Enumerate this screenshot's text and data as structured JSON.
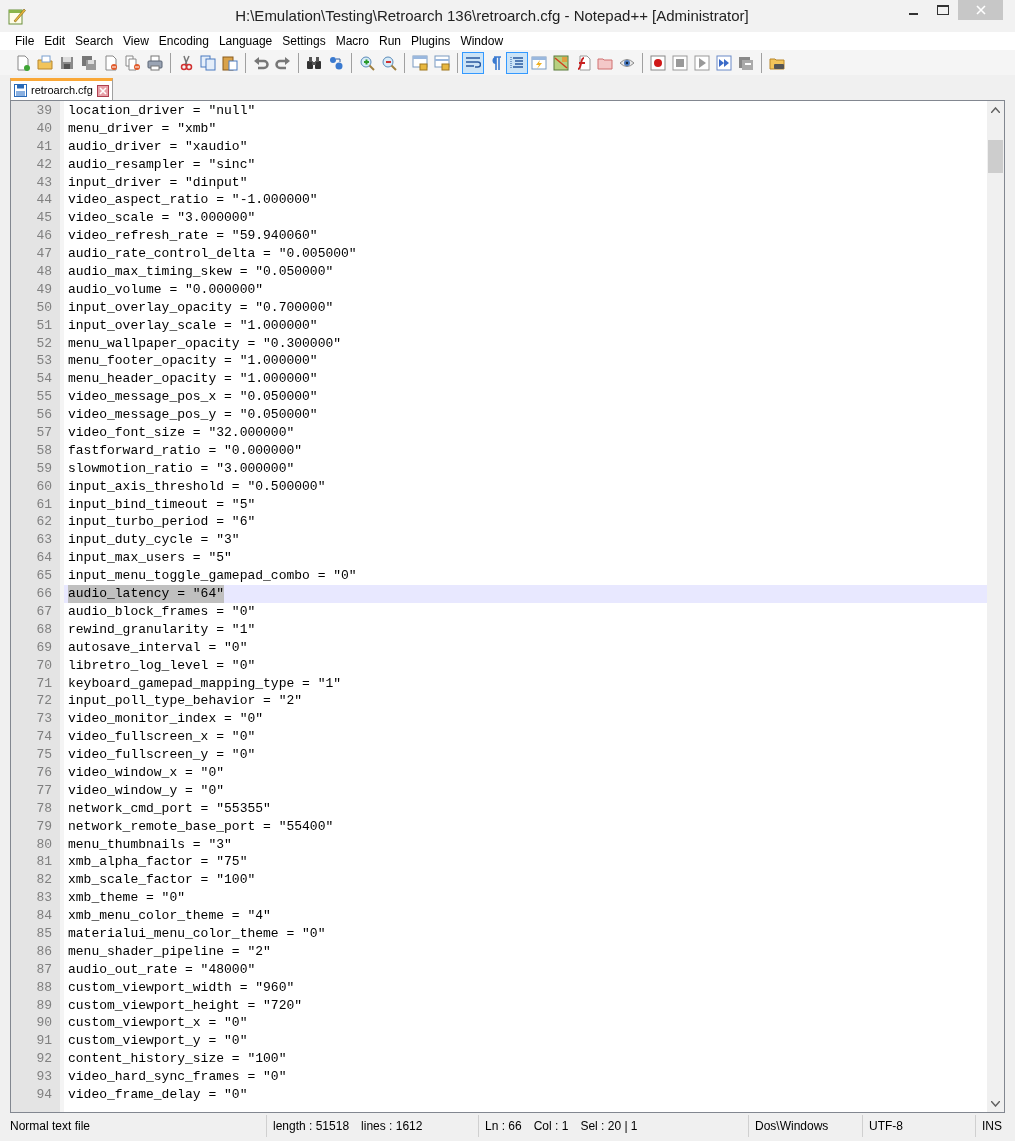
{
  "window": {
    "title": "H:\\Emulation\\Testing\\Retroarch 136\\retroarch.cfg - Notepad++ [Administrator]"
  },
  "menu": [
    "File",
    "Edit",
    "Search",
    "View",
    "Encoding",
    "Language",
    "Settings",
    "Macro",
    "Run",
    "Plugins",
    "Window"
  ],
  "toolbar": [
    [
      {
        "kind": "new",
        "pressed": false
      },
      {
        "kind": "open",
        "pressed": false
      },
      {
        "kind": "save",
        "pressed": false
      },
      {
        "kind": "save-all",
        "pressed": false
      },
      {
        "kind": "close",
        "pressed": false
      },
      {
        "kind": "close-all",
        "pressed": false
      },
      {
        "kind": "print",
        "pressed": false
      }
    ],
    [
      {
        "kind": "cut",
        "pressed": false
      },
      {
        "kind": "copy",
        "pressed": false
      },
      {
        "kind": "paste",
        "pressed": false
      }
    ],
    [
      {
        "kind": "undo",
        "pressed": false
      },
      {
        "kind": "redo",
        "pressed": false
      }
    ],
    [
      {
        "kind": "find",
        "pressed": false
      },
      {
        "kind": "replace",
        "pressed": false
      }
    ],
    [
      {
        "kind": "zoom-in",
        "pressed": false
      },
      {
        "kind": "zoom-out",
        "pressed": false
      }
    ],
    [
      {
        "kind": "sync-vertical",
        "pressed": false
      },
      {
        "kind": "sync-horizontal",
        "pressed": false
      }
    ],
    [
      {
        "kind": "word-wrap",
        "pressed": true
      },
      {
        "kind": "show-all",
        "pressed": false
      },
      {
        "kind": "indent-guide",
        "pressed": true
      },
      {
        "kind": "language",
        "pressed": false
      },
      {
        "kind": "map",
        "pressed": false
      },
      {
        "kind": "function",
        "pressed": false
      },
      {
        "kind": "folder",
        "pressed": false
      },
      {
        "kind": "monitor",
        "pressed": false
      }
    ],
    [
      {
        "kind": "record",
        "pressed": false
      },
      {
        "kind": "stop",
        "pressed": false
      },
      {
        "kind": "play",
        "pressed": false
      },
      {
        "kind": "play-multi",
        "pressed": false
      },
      {
        "kind": "save-macro",
        "pressed": false
      }
    ],
    [
      {
        "kind": "launch",
        "pressed": false
      }
    ]
  ],
  "tabs": [
    {
      "label": "retroarch.cfg",
      "selected": true
    }
  ],
  "lines": [
    {
      "number": "39",
      "text": "location_driver = \"null\"",
      "current": false,
      "selected": false
    },
    {
      "number": "40",
      "text": "menu_driver = \"xmb\"",
      "current": false,
      "selected": false
    },
    {
      "number": "41",
      "text": "audio_driver = \"xaudio\"",
      "current": false,
      "selected": false
    },
    {
      "number": "42",
      "text": "audio_resampler = \"sinc\"",
      "current": false,
      "selected": false
    },
    {
      "number": "43",
      "text": "input_driver = \"dinput\"",
      "current": false,
      "selected": false
    },
    {
      "number": "44",
      "text": "video_aspect_ratio = \"-1.000000\"",
      "current": false,
      "selected": false
    },
    {
      "number": "45",
      "text": "video_scale = \"3.000000\"",
      "current": false,
      "selected": false
    },
    {
      "number": "46",
      "text": "video_refresh_rate = \"59.940060\"",
      "current": false,
      "selected": false
    },
    {
      "number": "47",
      "text": "audio_rate_control_delta = \"0.005000\"",
      "current": false,
      "selected": false
    },
    {
      "number": "48",
      "text": "audio_max_timing_skew = \"0.050000\"",
      "current": false,
      "selected": false
    },
    {
      "number": "49",
      "text": "audio_volume = \"0.000000\"",
      "current": false,
      "selected": false
    },
    {
      "number": "50",
      "text": "input_overlay_opacity = \"0.700000\"",
      "current": false,
      "selected": false
    },
    {
      "number": "51",
      "text": "input_overlay_scale = \"1.000000\"",
      "current": false,
      "selected": false
    },
    {
      "number": "52",
      "text": "menu_wallpaper_opacity = \"0.300000\"",
      "current": false,
      "selected": false
    },
    {
      "number": "53",
      "text": "menu_footer_opacity = \"1.000000\"",
      "current": false,
      "selected": false
    },
    {
      "number": "54",
      "text": "menu_header_opacity = \"1.000000\"",
      "current": false,
      "selected": false
    },
    {
      "number": "55",
      "text": "video_message_pos_x = \"0.050000\"",
      "current": false,
      "selected": false
    },
    {
      "number": "56",
      "text": "video_message_pos_y = \"0.050000\"",
      "current": false,
      "selected": false
    },
    {
      "number": "57",
      "text": "video_font_size = \"32.000000\"",
      "current": false,
      "selected": false
    },
    {
      "number": "58",
      "text": "fastforward_ratio = \"0.000000\"",
      "current": false,
      "selected": false
    },
    {
      "number": "59",
      "text": "slowmotion_ratio = \"3.000000\"",
      "current": false,
      "selected": false
    },
    {
      "number": "60",
      "text": "input_axis_threshold = \"0.500000\"",
      "current": false,
      "selected": false
    },
    {
      "number": "61",
      "text": "input_bind_timeout = \"5\"",
      "current": false,
      "selected": false
    },
    {
      "number": "62",
      "text": "input_turbo_period = \"6\"",
      "current": false,
      "selected": false
    },
    {
      "number": "63",
      "text": "input_duty_cycle = \"3\"",
      "current": false,
      "selected": false
    },
    {
      "number": "64",
      "text": "input_max_users = \"5\"",
      "current": false,
      "selected": false
    },
    {
      "number": "65",
      "text": "input_menu_toggle_gamepad_combo = \"0\"",
      "current": false,
      "selected": false
    },
    {
      "number": "66",
      "text": "audio_latency = \"64\"",
      "current": true,
      "selected": true
    },
    {
      "number": "67",
      "text": "audio_block_frames = \"0\"",
      "current": false,
      "selected": false
    },
    {
      "number": "68",
      "text": "rewind_granularity = \"1\"",
      "current": false,
      "selected": false
    },
    {
      "number": "69",
      "text": "autosave_interval = \"0\"",
      "current": false,
      "selected": false
    },
    {
      "number": "70",
      "text": "libretro_log_level = \"0\"",
      "current": false,
      "selected": false
    },
    {
      "number": "71",
      "text": "keyboard_gamepad_mapping_type = \"1\"",
      "current": false,
      "selected": false
    },
    {
      "number": "72",
      "text": "input_poll_type_behavior = \"2\"",
      "current": false,
      "selected": false
    },
    {
      "number": "73",
      "text": "video_monitor_index = \"0\"",
      "current": false,
      "selected": false
    },
    {
      "number": "74",
      "text": "video_fullscreen_x = \"0\"",
      "current": false,
      "selected": false
    },
    {
      "number": "75",
      "text": "video_fullscreen_y = \"0\"",
      "current": false,
      "selected": false
    },
    {
      "number": "76",
      "text": "video_window_x = \"0\"",
      "current": false,
      "selected": false
    },
    {
      "number": "77",
      "text": "video_window_y = \"0\"",
      "current": false,
      "selected": false
    },
    {
      "number": "78",
      "text": "network_cmd_port = \"55355\"",
      "current": false,
      "selected": false
    },
    {
      "number": "79",
      "text": "network_remote_base_port = \"55400\"",
      "current": false,
      "selected": false
    },
    {
      "number": "80",
      "text": "menu_thumbnails = \"3\"",
      "current": false,
      "selected": false
    },
    {
      "number": "81",
      "text": "xmb_alpha_factor = \"75\"",
      "current": false,
      "selected": false
    },
    {
      "number": "82",
      "text": "xmb_scale_factor = \"100\"",
      "current": false,
      "selected": false
    },
    {
      "number": "83",
      "text": "xmb_theme = \"0\"",
      "current": false,
      "selected": false
    },
    {
      "number": "84",
      "text": "xmb_menu_color_theme = \"4\"",
      "current": false,
      "selected": false
    },
    {
      "number": "85",
      "text": "materialui_menu_color_theme = \"0\"",
      "current": false,
      "selected": false
    },
    {
      "number": "86",
      "text": "menu_shader_pipeline = \"2\"",
      "current": false,
      "selected": false
    },
    {
      "number": "87",
      "text": "audio_out_rate = \"48000\"",
      "current": false,
      "selected": false
    },
    {
      "number": "88",
      "text": "custom_viewport_width = \"960\"",
      "current": false,
      "selected": false
    },
    {
      "number": "89",
      "text": "custom_viewport_height = \"720\"",
      "current": false,
      "selected": false
    },
    {
      "number": "90",
      "text": "custom_viewport_x = \"0\"",
      "current": false,
      "selected": false
    },
    {
      "number": "91",
      "text": "custom_viewport_y = \"0\"",
      "current": false,
      "selected": false
    },
    {
      "number": "92",
      "text": "content_history_size = \"100\"",
      "current": false,
      "selected": false
    },
    {
      "number": "93",
      "text": "video_hard_sync_frames = \"0\"",
      "current": false,
      "selected": false
    },
    {
      "number": "94",
      "text": "video_frame_delay = \"0\"",
      "current": false,
      "selected": false
    }
  ],
  "status_bar": [
    [
      "Normal text file"
    ],
    [
      "length : 51518",
      "lines : 1612"
    ],
    [
      "Ln : 66",
      "Col : 1",
      "Sel : 20 | 1"
    ],
    [
      "Dos\\Windows"
    ],
    [
      "UTF-8"
    ],
    [
      "INS"
    ]
  ]
}
